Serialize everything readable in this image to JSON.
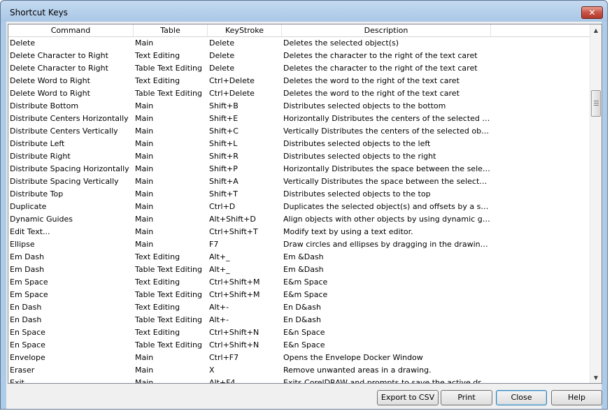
{
  "window": {
    "title": "Shortcut Keys",
    "close_glyph": "✕"
  },
  "table": {
    "columns": [
      "Command",
      "Table",
      "KeyStroke",
      "Description"
    ],
    "rows": [
      [
        "Delete",
        "Main",
        "Delete",
        "Deletes the selected object(s)"
      ],
      [
        "Delete Character to Right",
        "Text Editing",
        "Delete",
        "Deletes the character to the right of the text caret"
      ],
      [
        "Delete Character to Right",
        "Table Text Editing",
        "Delete",
        "Deletes the character to the right of the text caret"
      ],
      [
        "Delete Word to Right",
        "Text Editing",
        "Ctrl+Delete",
        "Deletes the word to the right of the text caret"
      ],
      [
        "Delete Word to Right",
        "Table Text Editing",
        "Ctrl+Delete",
        "Deletes the word to the right of the text caret"
      ],
      [
        "Distribute Bottom",
        "Main",
        "Shift+B",
        "Distributes selected objects to the bottom"
      ],
      [
        "Distribute Centers Horizontally",
        "Main",
        "Shift+E",
        "Horizontally Distributes the centers of the selected objects"
      ],
      [
        "Distribute Centers Vertically",
        "Main",
        "Shift+C",
        "Vertically Distributes the centers of the selected objects"
      ],
      [
        "Distribute Left",
        "Main",
        "Shift+L",
        "Distributes selected objects to the left"
      ],
      [
        "Distribute Right",
        "Main",
        "Shift+R",
        "Distributes selected objects to the right"
      ],
      [
        "Distribute Spacing Horizontally",
        "Main",
        "Shift+P",
        "Horizontally Distributes the space between the selected ob..."
      ],
      [
        "Distribute Spacing Vertically",
        "Main",
        "Shift+A",
        "Vertically Distributes the space between the selected objects"
      ],
      [
        "Distribute Top",
        "Main",
        "Shift+T",
        "Distributes selected objects to the top"
      ],
      [
        "Duplicate",
        "Main",
        "Ctrl+D",
        "Duplicates the selected object(s) and offsets by a specifie..."
      ],
      [
        "Dynamic Guides",
        "Main",
        "Alt+Shift+D",
        "Align objects with other objects by using dynamic guidelines."
      ],
      [
        "Edit Text...",
        "Main",
        "Ctrl+Shift+T",
        "Modify text by using a text editor."
      ],
      [
        "Ellipse",
        "Main",
        "F7",
        "Draw circles and ellipses by dragging in the drawing window."
      ],
      [
        "Em Dash",
        "Text Editing",
        "Alt+_",
        "Em &Dash"
      ],
      [
        "Em Dash",
        "Table Text Editing",
        "Alt+_",
        "Em &Dash"
      ],
      [
        "Em Space",
        "Text Editing",
        "Ctrl+Shift+M",
        "E&m Space"
      ],
      [
        "Em Space",
        "Table Text Editing",
        "Ctrl+Shift+M",
        "E&m Space"
      ],
      [
        "En Dash",
        "Text Editing",
        "Alt+-",
        "En D&ash"
      ],
      [
        "En Dash",
        "Table Text Editing",
        "Alt+-",
        "En D&ash"
      ],
      [
        "En Space",
        "Text Editing",
        "Ctrl+Shift+N",
        "E&n Space"
      ],
      [
        "En Space",
        "Table Text Editing",
        "Ctrl+Shift+N",
        "E&n Space"
      ],
      [
        "Envelope",
        "Main",
        "Ctrl+F7",
        "Opens the Envelope Docker Window"
      ],
      [
        "Eraser",
        "Main",
        "X",
        "Remove unwanted areas in a drawing."
      ],
      [
        "Exit",
        "Main",
        "Alt+F4",
        "Exits CorelDRAW and prompts to save the active drawing"
      ]
    ]
  },
  "scrollbar": {
    "up_glyph": "▲",
    "down_glyph": "▼",
    "position": 0.2
  },
  "buttons": {
    "export_csv": "Export to CSV",
    "print": "Print",
    "close": "Close",
    "help": "Help"
  }
}
